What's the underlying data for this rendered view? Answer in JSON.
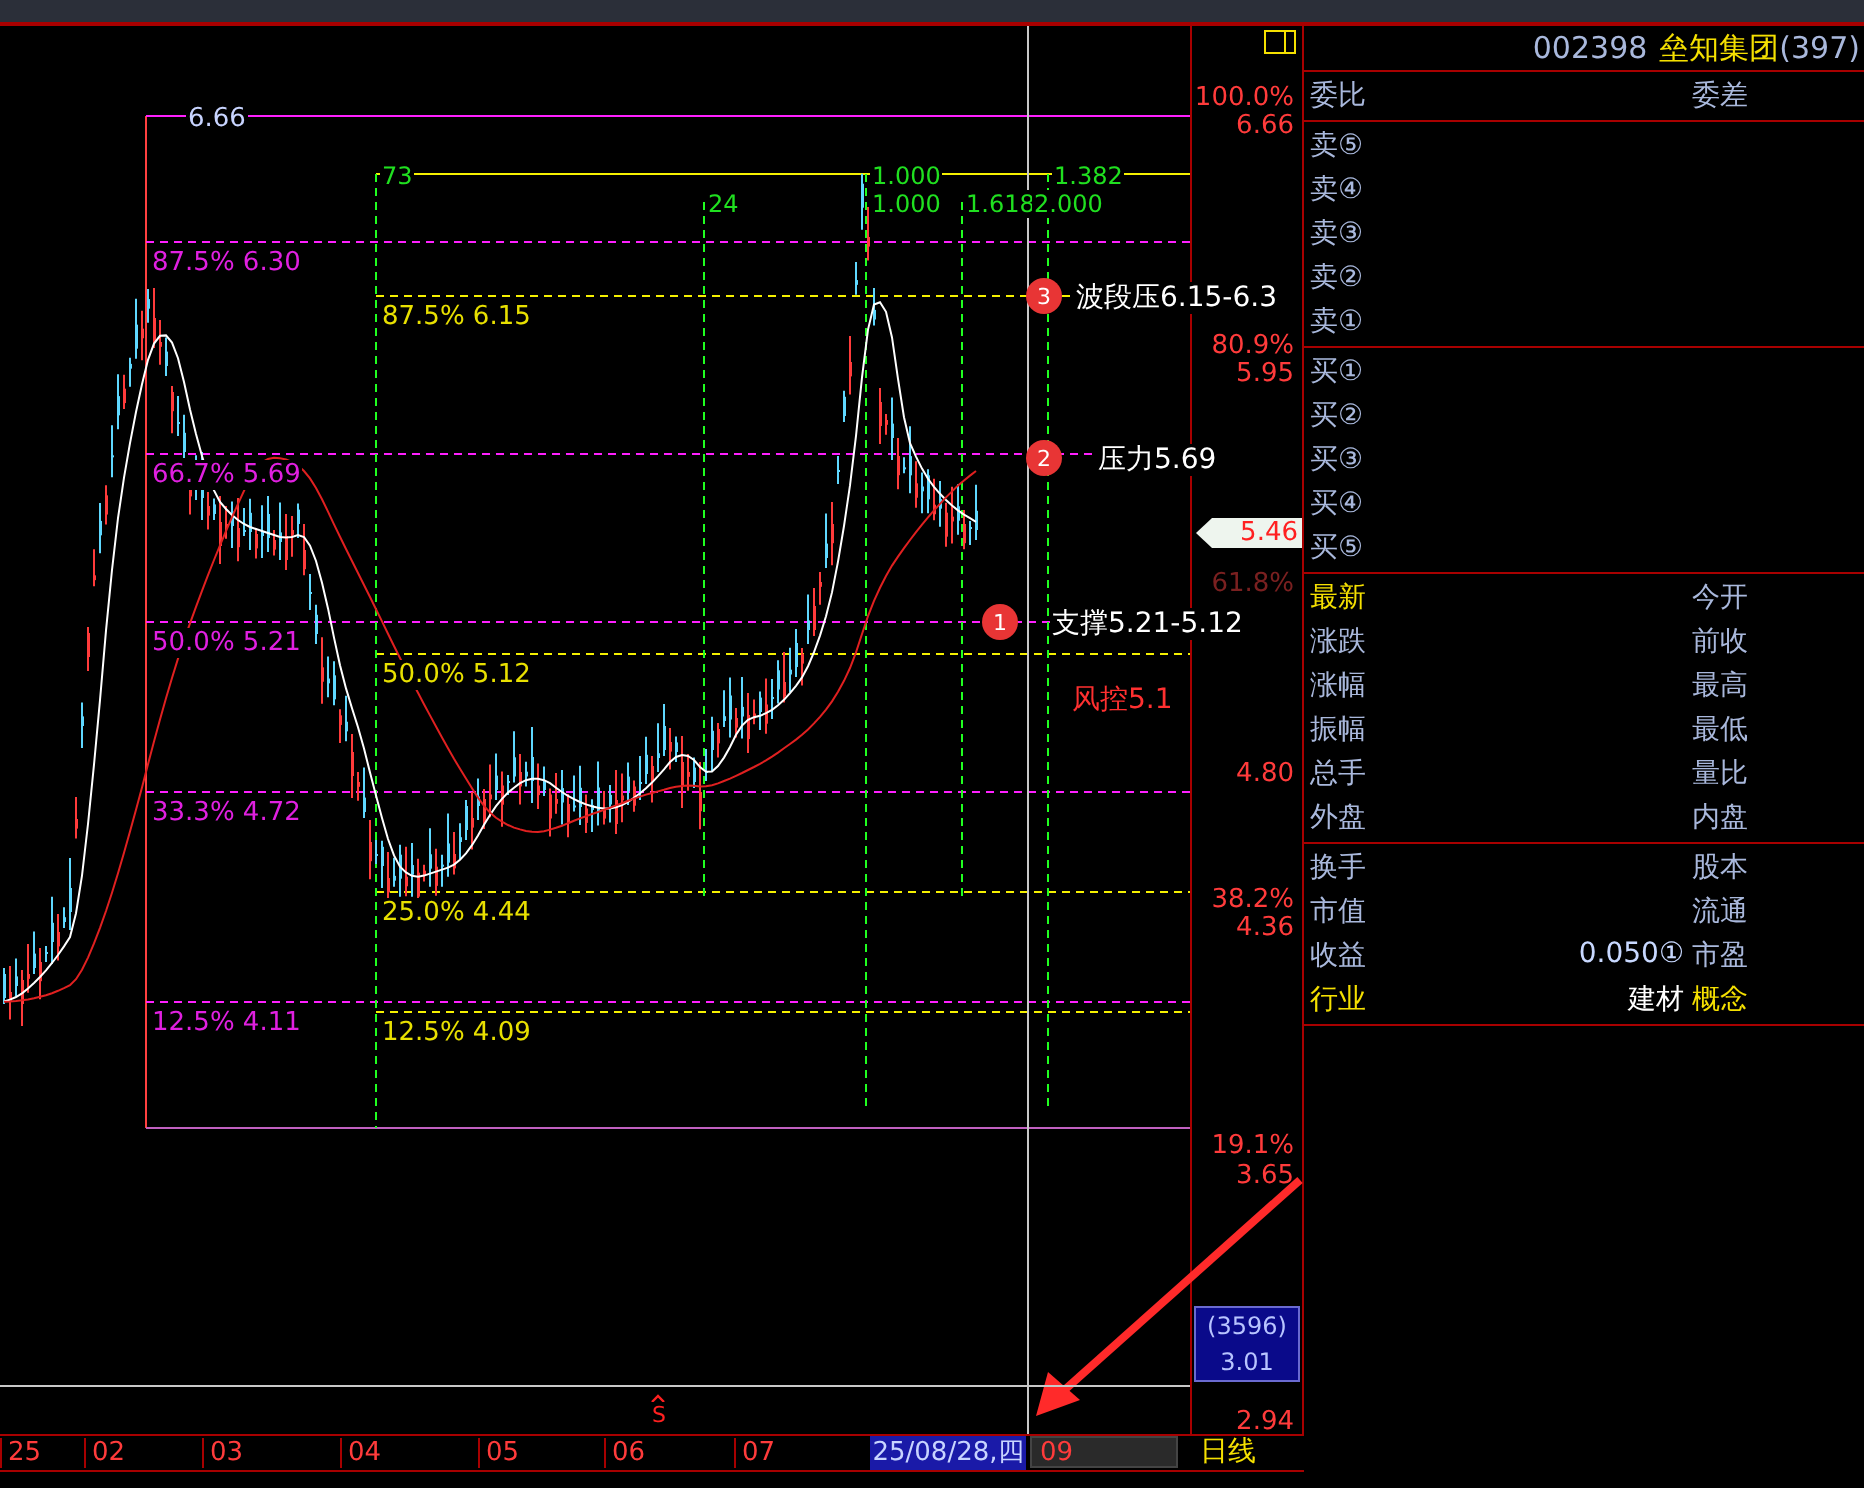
{
  "chart": {
    "high_label": "6.66",
    "fib_left": [
      "87.5% 6.30",
      "66.7% 5.69",
      "50.0% 5.21",
      "33.3% 4.72",
      "12.5% 4.11"
    ],
    "fib_right": [
      "87.5% 6.15",
      "50.0% 5.12",
      "25.0% 4.44",
      "12.5% 4.09"
    ],
    "time_labels": [
      "73",
      "24",
      "1.000",
      "1.000",
      "1.618",
      "2.000",
      "1.382"
    ],
    "markers": [
      {
        "number": "3",
        "text": "波段压6.15-6.3"
      },
      {
        "number": "2",
        "text": "压力5.69"
      },
      {
        "number": "1",
        "text": "支撑5.21-5.12"
      }
    ],
    "risk_note": "风控5.1",
    "signal": "S"
  },
  "price_axis": {
    "labels": [
      {
        "kind": "pct",
        "text": "100.0%"
      },
      {
        "kind": "price",
        "text": "6.66"
      },
      {
        "kind": "pct",
        "text": "80.9%"
      },
      {
        "kind": "price",
        "text": "5.95"
      },
      {
        "kind": "dim",
        "text": "61.8%"
      },
      {
        "kind": "price",
        "text": "4.80"
      },
      {
        "kind": "pct",
        "text": "38.2%"
      },
      {
        "kind": "price",
        "text": "4.36"
      },
      {
        "kind": "pct",
        "text": "19.1%"
      },
      {
        "kind": "price",
        "text": "3.65"
      }
    ],
    "current_price": "5.46",
    "volume": {
      "count": "(3596)",
      "value": "3.01"
    },
    "volume_tick": "2.94"
  },
  "date_axis": {
    "dates": [
      "25",
      "02",
      "03",
      "04",
      "05",
      "06",
      "07"
    ],
    "cursor_date": "25/08/28,四",
    "next_month": "09",
    "period": "日线"
  },
  "quote_panel": {
    "code": "002398",
    "name": "垒知集团",
    "count": "(397)",
    "order_header": [
      "委比",
      "委差"
    ],
    "asks": [
      "卖⑤",
      "卖④",
      "卖③",
      "卖②",
      "卖①"
    ],
    "bids": [
      "买①",
      "买②",
      "买③",
      "买④",
      "买⑤"
    ],
    "stats": [
      {
        "left": "最新",
        "right": "今开",
        "left_highlighted": true,
        "right_highlighted": false
      },
      {
        "left": "涨跌",
        "right": "前收",
        "left_highlighted": false,
        "right_highlighted": false
      },
      {
        "left": "涨幅",
        "right": "最高",
        "left_highlighted": false,
        "right_highlighted": false
      },
      {
        "left": "振幅",
        "right": "最低",
        "left_highlighted": false,
        "right_highlighted": false
      },
      {
        "left": "总手",
        "right": "量比",
        "left_highlighted": false,
        "right_highlighted": false
      },
      {
        "left": "外盘",
        "right": "内盘",
        "left_highlighted": false,
        "right_highlighted": false
      }
    ],
    "info": [
      {
        "left": "换手",
        "right": "股本",
        "left_highlighted": false,
        "right_highlighted": false
      },
      {
        "left": "市值",
        "right": "流通",
        "left_highlighted": false,
        "right_highlighted": false
      },
      {
        "left": "收益",
        "value": "0.050①",
        "right": "市盈",
        "left_highlighted": false,
        "right_highlighted": false
      },
      {
        "left": "行业",
        "value": "建材",
        "right": "概念",
        "left_highlighted": true,
        "right_highlighted": true
      }
    ]
  }
}
